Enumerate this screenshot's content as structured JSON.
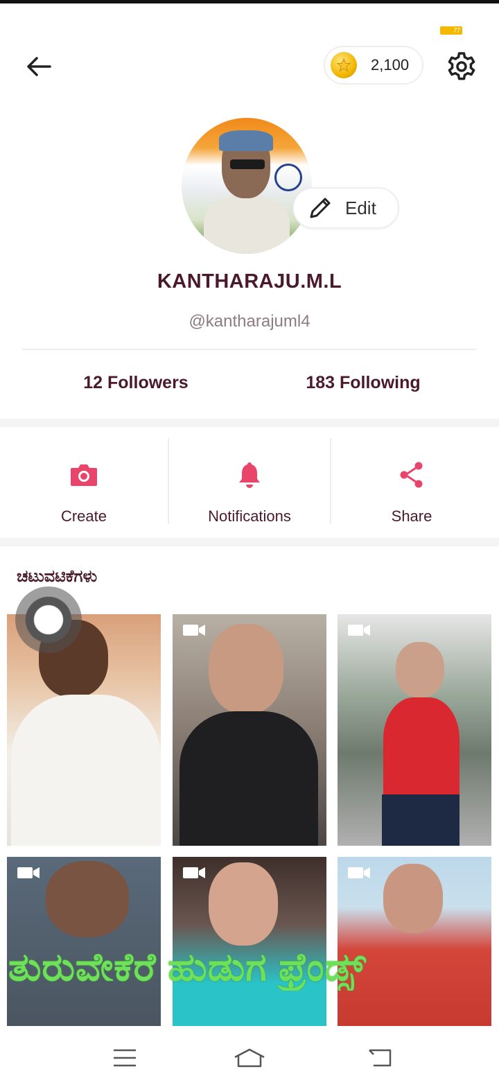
{
  "status": {
    "battery_label": "77"
  },
  "header": {
    "coins": "2,100"
  },
  "profile": {
    "edit_label": "Edit",
    "name": "KANTHARAJU.M.L",
    "handle": "@kantharajuml4"
  },
  "stats": {
    "followers": "12 Followers",
    "following": "183 Following"
  },
  "actions": [
    {
      "label": "Create",
      "icon": "camera-icon"
    },
    {
      "label": "Notifications",
      "icon": "bell-icon"
    },
    {
      "label": "Share",
      "icon": "share-icon"
    }
  ],
  "activities": {
    "title": "ಚಟುವಟಿಕೆಗಳು",
    "videos": [
      {
        "icon": "video-camera-icon"
      },
      {
        "icon": "video-camera-icon"
      },
      {
        "icon": "video-camera-icon"
      },
      {
        "icon": "video-camera-icon"
      },
      {
        "icon": "video-camera-icon"
      },
      {
        "icon": "video-camera-icon"
      }
    ],
    "overlay_caption": "ತುರುವೇಕೆರೆ ಹುಡುಗ ಫ್ರೆಂಡ್ಸ್"
  },
  "colors": {
    "accent": "#e9456b",
    "text": "#4a1a2c",
    "handle": "#8e7b82",
    "caption": "#6ee05a"
  }
}
